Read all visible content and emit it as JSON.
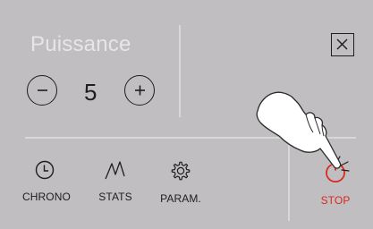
{
  "power": {
    "title": "Puissance",
    "value": "5",
    "decrement_symbol": "minus",
    "increment_symbol": "plus"
  },
  "toolbar": {
    "chrono_label": "CHRONO",
    "stats_label": "STATS",
    "param_label": "PARAM.",
    "stop_label": "STOP"
  },
  "icons": {
    "close": "close-icon",
    "chrono": "clock-icon",
    "stats": "line-graph-icon",
    "param": "gear-icon",
    "stop": "power-icon",
    "pointer": "pointing-hand-icon"
  },
  "colors": {
    "background": "#c1bec1",
    "title_text": "#e7e5e7",
    "dark": "#1e1e1e",
    "divider": "#d9d7d9",
    "stop_red": "#d82a1e"
  }
}
